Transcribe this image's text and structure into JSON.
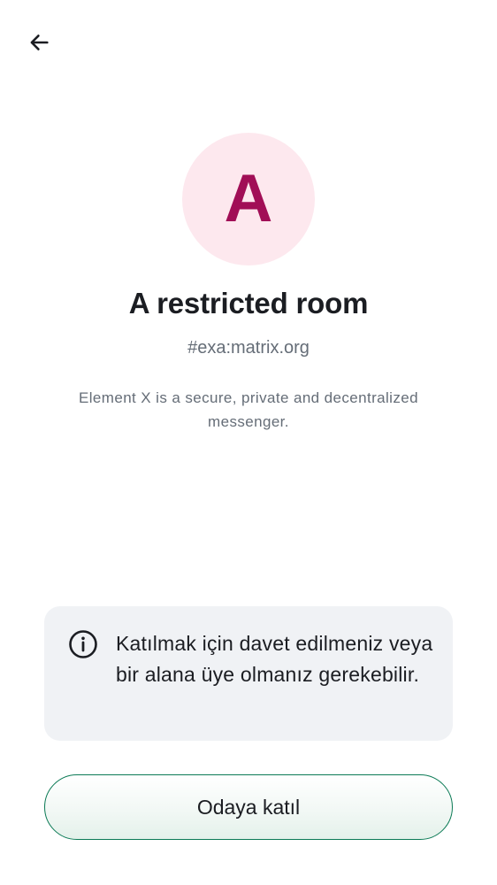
{
  "header": {
    "back_icon": "arrow-left-icon"
  },
  "room": {
    "avatar_letter": "A",
    "avatar_bg_color": "#fde8ee",
    "avatar_text_color": "#a10e56",
    "name": "A restricted room",
    "alias": "#exa:matrix.org",
    "topic": "Element X is a secure, private and decentralized messenger."
  },
  "notice": {
    "icon": "info-icon",
    "text": "Katılmak için davet edilmeniz veya bir alana üye olmanız gerekebilir."
  },
  "actions": {
    "join_label": "Odaya katıl",
    "accent_color": "#0b7a55"
  }
}
